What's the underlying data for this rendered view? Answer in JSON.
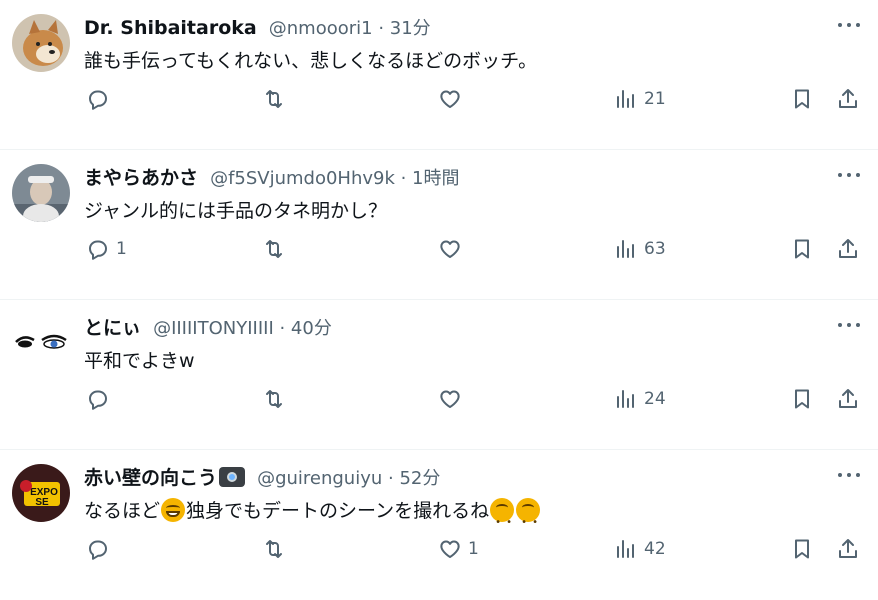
{
  "tweets": [
    {
      "name": "Dr. Shibaitaroka",
      "meta": "@nmooori1 · 31分",
      "text": "誰も手伝ってもくれない、悲しくなるほどのボッチ。",
      "reply_count": "",
      "retweet_count": "",
      "like_count": "",
      "views": "21",
      "avatar_icon": "shiba-dog-avatar"
    },
    {
      "name": "まやらあかさ",
      "meta": "@f5SVjumdo0Hhv9k · 1時間",
      "text": "ジャンル的には手品のタネ明かし？",
      "reply_count": "1",
      "retweet_count": "",
      "like_count": "",
      "views": "63",
      "avatar_icon": "person-photo-avatar"
    },
    {
      "name": "とにぃ",
      "meta": "@IIIIITONYIIIII · 40分",
      "text": "平和でよきw",
      "reply_count": "",
      "retweet_count": "",
      "like_count": "",
      "views": "24",
      "avatar_icon": "eyes-avatar"
    },
    {
      "name": "赤い壁の向こう",
      "meta": "@guirenguiyu · 52分",
      "text_a": "なるほど",
      "text_b": "独身でもデートのシーンを撮れるね",
      "text_c": "",
      "reply_count": "",
      "retweet_count": "",
      "like_count": "1",
      "views": "42",
      "avatar_text_1": "EXPO",
      "avatar_text_2": "SE",
      "avatar_icon": "expose-logo-avatar"
    }
  ],
  "colors": {
    "text": "#0f1419",
    "secondary": "#536471",
    "divider": "#eff3f4"
  }
}
